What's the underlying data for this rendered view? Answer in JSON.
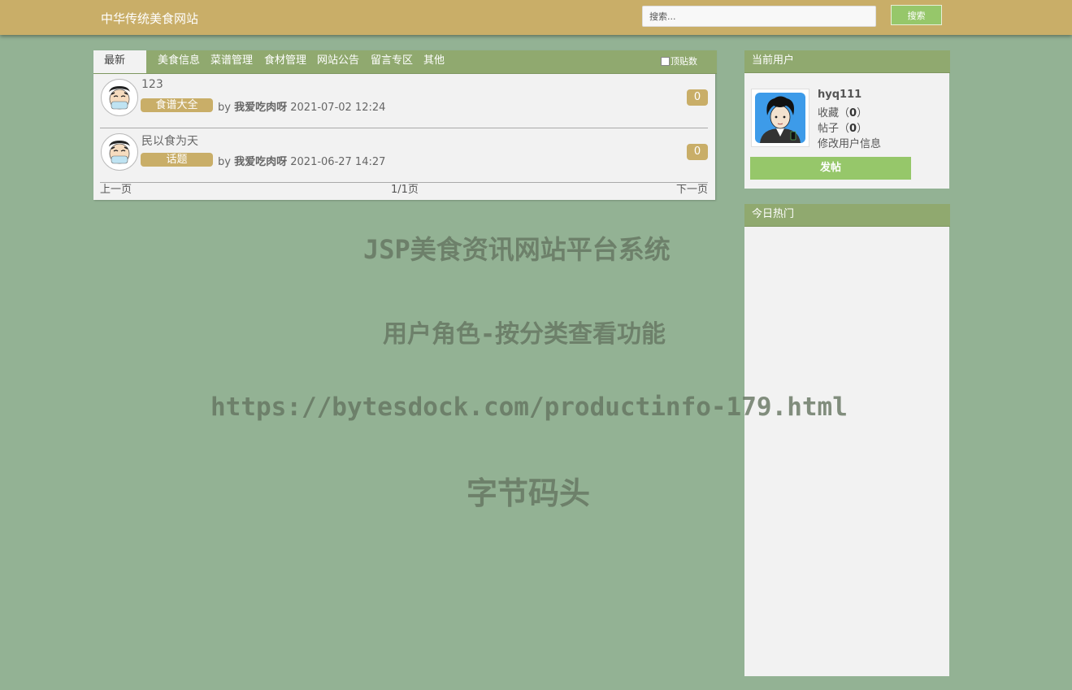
{
  "header": {
    "site_title": "中华传统美食网站",
    "search_placeholder": "搜索...",
    "search_button": "搜索"
  },
  "tabs": [
    "最新",
    "美食信息",
    "菜谱管理",
    "食材管理",
    "网站公告",
    "留言专区",
    "其他"
  ],
  "pin_filter_label": "顶贴数",
  "posts": [
    {
      "title": "123",
      "category": "食谱大全",
      "by": "by",
      "author": "我爱吃肉呀",
      "datetime": "2021-07-02 12:24",
      "count": "0"
    },
    {
      "title": "民以食为天",
      "category": "话题",
      "by": "by",
      "author": "我爱吃肉呀",
      "datetime": "2021-06-27 14:27",
      "count": "0"
    }
  ],
  "pager": {
    "prev": "上一页",
    "indicator": "1/1页",
    "next": "下一页"
  },
  "current_user": {
    "header": "当前用户",
    "username": "hyq111",
    "favorites_label": "收藏",
    "favorites_count": "0",
    "posts_label": "帖子",
    "posts_count": "0",
    "edit_profile": "修改用户信息",
    "post_button": "发帖"
  },
  "hot_today": {
    "header": "今日热门"
  },
  "watermark": {
    "line1": "JSP美食资讯网站平台系统",
    "line2": "用户角色-按分类查看功能",
    "line3": "https://bytesdock.com/productinfo-179.html",
    "line4": "字节码头"
  },
  "colors": {
    "header_bg": "#c9ae68",
    "page_bg": "#93b294",
    "tab_bar": "#90a96f",
    "accent_green": "#96c76a"
  }
}
